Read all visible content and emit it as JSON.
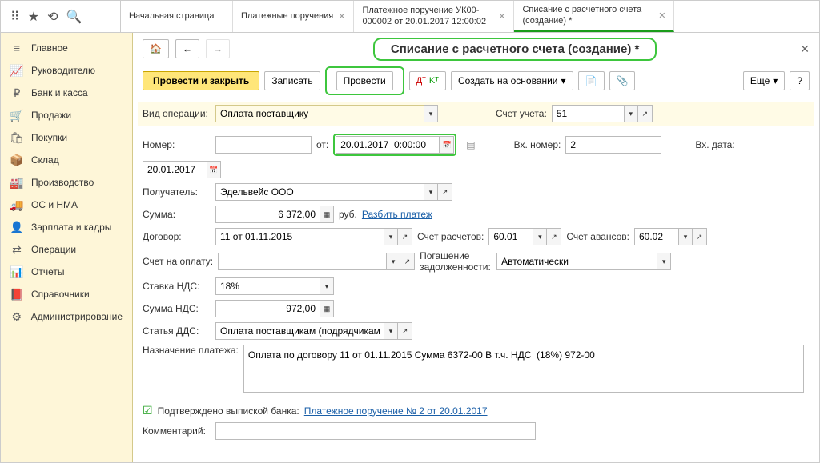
{
  "tabs": [
    {
      "label": "Начальная страница",
      "closable": false
    },
    {
      "label": "Платежные поручения",
      "closable": true
    },
    {
      "label": "Платежное поручение УК00-000002 от 20.01.2017 12:00:02",
      "closable": true
    },
    {
      "label": "Списание с расчетного счета (создание) *",
      "closable": true,
      "active": true
    }
  ],
  "sidebar": [
    {
      "icon": "≡",
      "label": "Главное"
    },
    {
      "icon": "📈",
      "label": "Руководителю"
    },
    {
      "icon": "₽",
      "label": "Банк и касса"
    },
    {
      "icon": "🛒",
      "label": "Продажи"
    },
    {
      "icon": "🛍",
      "label": "Покупки"
    },
    {
      "icon": "📦",
      "label": "Склад"
    },
    {
      "icon": "🏭",
      "label": "Производство"
    },
    {
      "icon": "🚚",
      "label": "ОС и НМА"
    },
    {
      "icon": "👤",
      "label": "Зарплата и кадры"
    },
    {
      "icon": "⇄",
      "label": "Операции"
    },
    {
      "icon": "📊",
      "label": "Отчеты"
    },
    {
      "icon": "📕",
      "label": "Справочники"
    },
    {
      "icon": "⚙",
      "label": "Администрирование"
    }
  ],
  "title": "Списание с расчетного счета (создание) *",
  "toolbar": {
    "post_close": "Провести и закрыть",
    "save": "Записать",
    "post": "Провести",
    "create_based": "Создать на основании",
    "more": "Еще"
  },
  "fields": {
    "op_type_label": "Вид операции:",
    "op_type": "Оплата поставщику",
    "account_label": "Счет учета:",
    "account": "51",
    "number_label": "Номер:",
    "number": "",
    "from_label": "от:",
    "date": "20.01.2017  0:00:00",
    "in_number_label": "Вх. номер:",
    "in_number": "2",
    "in_date_label": "Вх. дата:",
    "in_date": "20.01.2017",
    "recipient_label": "Получатель:",
    "recipient": "Эдельвейс ООО",
    "sum_label": "Сумма:",
    "sum": "6 372,00",
    "currency": "руб.",
    "split_link": "Разбить платеж",
    "contract_label": "Договор:",
    "contract": "11 от 01.11.2015",
    "settle_acc_label": "Счет расчетов:",
    "settle_acc": "60.01",
    "advance_acc_label": "Счет авансов:",
    "advance_acc": "60.02",
    "invoice_label": "Счет на оплату:",
    "invoice": "",
    "debt_label": "Погашение задолженности:",
    "debt": "Автоматически",
    "vat_rate_label": "Ставка НДС:",
    "vat_rate": "18%",
    "vat_sum_label": "Сумма НДС:",
    "vat_sum": "972,00",
    "dds_label": "Статья ДДС:",
    "dds": "Оплата поставщикам (подрядчикам)",
    "purpose_label": "Назначение платежа:",
    "purpose": "Оплата по договору 11 от 01.11.2015 Сумма 6372-00 В т.ч. НДС  (18%) 972-00",
    "confirmed_label": "Подтверждено выпиской банка:",
    "confirmed_link": "Платежное поручение № 2 от 20.01.2017",
    "comment_label": "Комментарий:",
    "comment": ""
  }
}
